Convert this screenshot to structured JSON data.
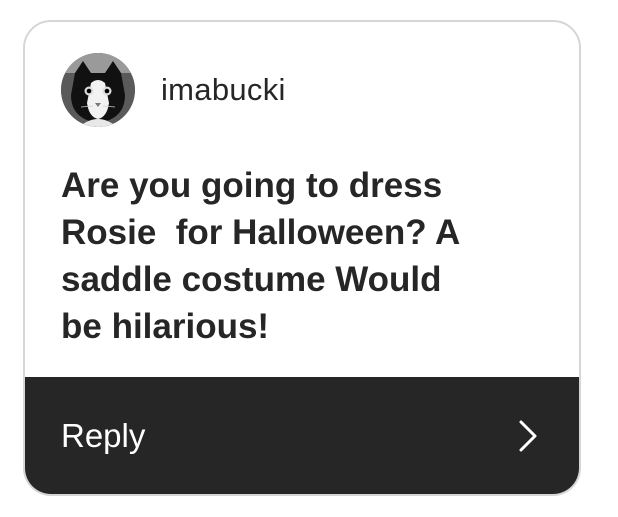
{
  "comment": {
    "username": "imabucki",
    "avatar_icon": "cat-avatar-icon",
    "text": "Are you going to dress\nRosie  for Halloween? A\nsaddle costume Would\nbe hilarious!"
  },
  "reply": {
    "label": "Reply",
    "icon": "chevron-right-icon"
  },
  "colors": {
    "bar_background": "#262626",
    "text": "#262626",
    "card_border": "#d6d6d6"
  }
}
